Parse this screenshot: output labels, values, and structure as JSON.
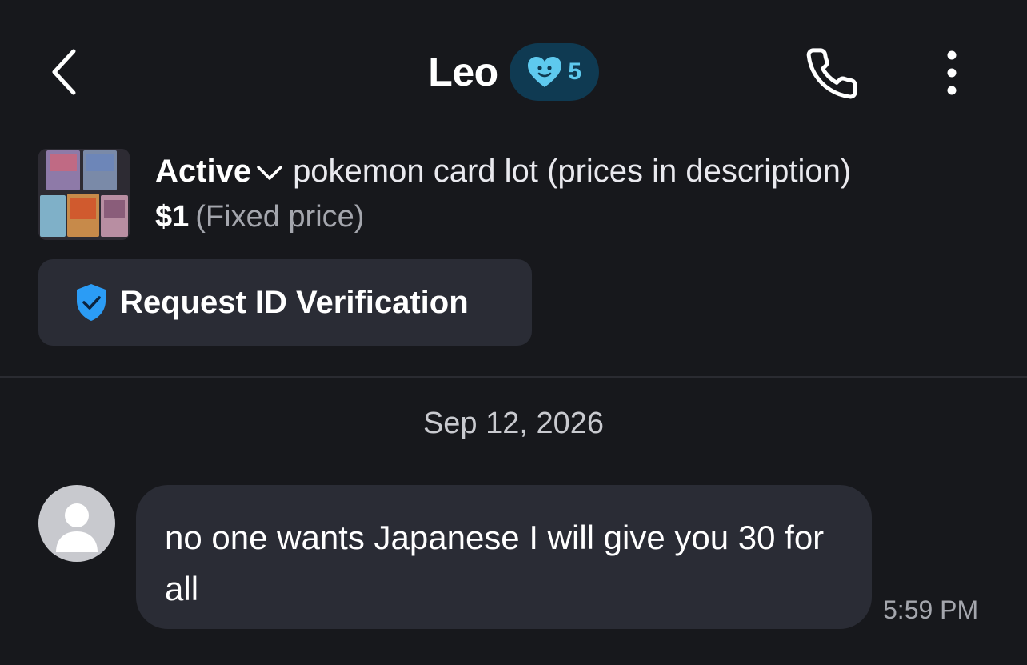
{
  "header": {
    "contact_name": "Leo",
    "badge_count": "5",
    "badge_icon": "heart-face-icon",
    "colors": {
      "badge_bg": "#0f3a52",
      "badge_accent": "#5ec9ee"
    }
  },
  "listing": {
    "status": "Active",
    "title": "pokemon card lot (prices in description)",
    "price": "$1",
    "price_type": "(Fixed price)"
  },
  "verification": {
    "label": "Request ID Verification",
    "icon": "shield-check-icon",
    "icon_color": "#2b9cf5"
  },
  "conversation": {
    "date": "Sep 12, 2026",
    "messages": [
      {
        "text": "no one wants Japanese I will give you 30 for all",
        "time": "5:59 PM"
      }
    ]
  }
}
